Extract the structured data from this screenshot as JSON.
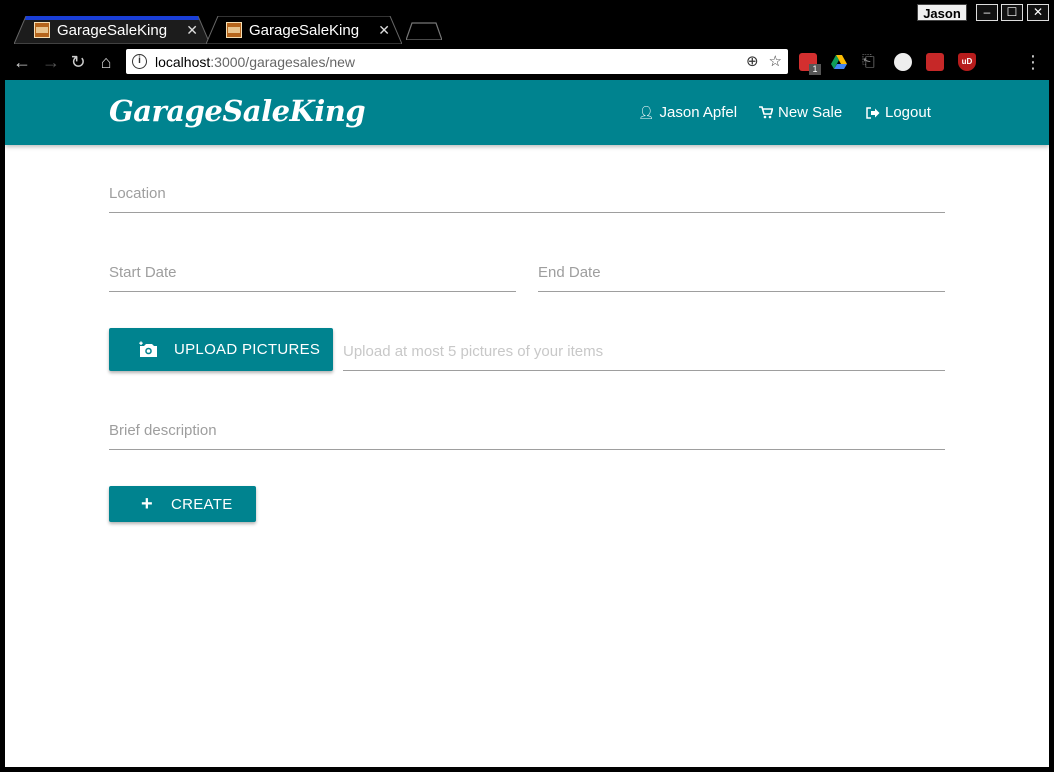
{
  "browser": {
    "user_badge": "Jason",
    "window_controls": {
      "minimize": "–",
      "maximize": "☐",
      "close": "✕"
    },
    "tabs": [
      {
        "title": "GarageSaleKing",
        "active": true
      },
      {
        "title": "GarageSaleKing",
        "active": false
      }
    ],
    "url_host": "localhost",
    "url_path": ":3000/garagesales/new",
    "extension_badge": "1",
    "extension_ublock": "uD",
    "accent_color": "#1a3fd8"
  },
  "navbar": {
    "brand": "GarageSaleKing",
    "user_link": "Jason Apfel",
    "new_sale_link": "New Sale",
    "logout_link": "Logout",
    "color": "#00838f"
  },
  "form": {
    "location_placeholder": "Location",
    "start_date_placeholder": "Start Date",
    "end_date_placeholder": "End Date",
    "upload_button_label": "Upload Pictures",
    "upload_placeholder": "Upload at most 5 pictures of your items",
    "description_placeholder": "Brief description",
    "create_button_label": "Create"
  }
}
